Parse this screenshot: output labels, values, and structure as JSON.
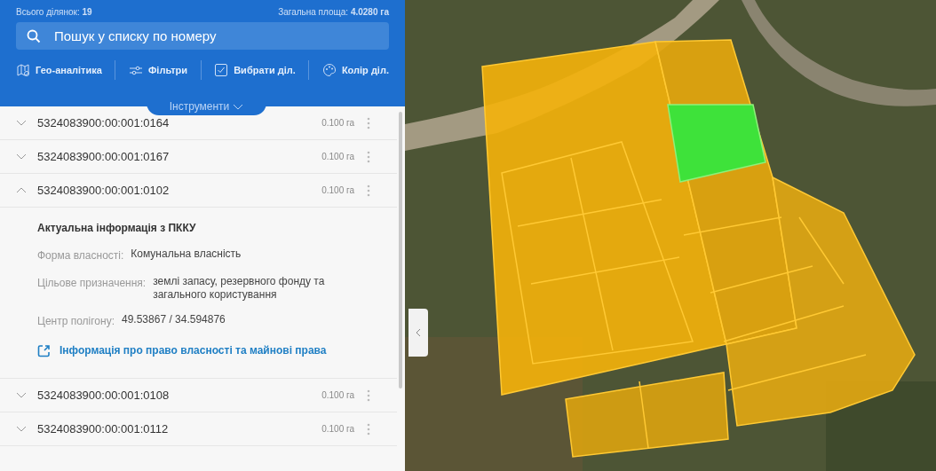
{
  "summary": {
    "total": "Всього ділянок: **19**",
    "area": "Загальна площа: **4.0280 га**"
  },
  "search": {
    "placeholder": "Пошук у списку по номеру"
  },
  "tools": [
    "Гео-аналітика",
    "Фільтри",
    "Вибрати діл.",
    "Колір діл."
  ],
  "tools_toggle": "Інструменти",
  "parcels": [
    {
      "number": "5324083900:00:001:0164",
      "area": "0.100 га",
      "expanded": false
    },
    {
      "number": "5324083900:00:001:0167",
      "area": "0.100 га",
      "expanded": false
    },
    {
      "number": "5324083900:00:001:0102",
      "area": "0.100 га",
      "expanded": true,
      "details": {
        "heading": "Актуальна інформація з ПККУ",
        "fields": [
          {
            "label": "Форма власності:",
            "value": "Комунальна власність"
          },
          {
            "label": "Цільове призначення:",
            "value": "землі запасу, резервного фонду та загального користування"
          },
          {
            "label": "Центр полігону:",
            "value": "49.53867 / 34.594876"
          }
        ],
        "link": "Інформація про право власності та майнові права"
      }
    },
    {
      "number": "5324083900:00:001:0108",
      "area": "0.100 га",
      "expanded": false
    },
    {
      "number": "5324083900:00:001:0112",
      "area": "0.100 га",
      "expanded": false
    }
  ]
}
